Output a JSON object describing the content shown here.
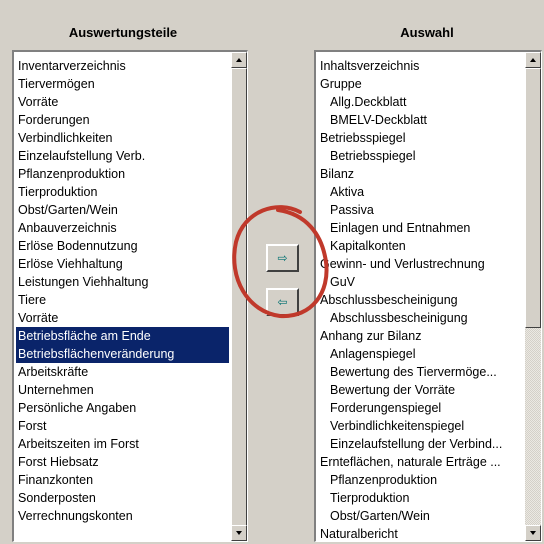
{
  "left_panel": {
    "header": "Auswertungsteile",
    "items": [
      {
        "label": "Inventarverzeichnis"
      },
      {
        "label": "Tiervermögen"
      },
      {
        "label": "Vorräte"
      },
      {
        "label": "Forderungen"
      },
      {
        "label": "Verbindlichkeiten"
      },
      {
        "label": "Einzelaufstellung Verb."
      },
      {
        "label": "Pflanzenproduktion"
      },
      {
        "label": "Tierproduktion"
      },
      {
        "label": "Obst/Garten/Wein"
      },
      {
        "label": "Anbauverzeichnis"
      },
      {
        "label": "Erlöse Bodennutzung"
      },
      {
        "label": "Erlöse Viehhaltung"
      },
      {
        "label": "Leistungen Viehhaltung"
      },
      {
        "label": "Tiere"
      },
      {
        "label": "Vorräte"
      },
      {
        "label": "Betriebsfläche am Ende",
        "selected": true
      },
      {
        "label": "Betriebsflächenveränderung",
        "selected": true
      },
      {
        "label": "Arbeitskräfte"
      },
      {
        "label": "Unternehmen"
      },
      {
        "label": "Persönliche Angaben"
      },
      {
        "label": "Forst"
      },
      {
        "label": "Arbeitszeiten im Forst"
      },
      {
        "label": "Forst Hiebsatz"
      },
      {
        "label": "Finanzkonten"
      },
      {
        "label": "Sonderposten"
      },
      {
        "label": "Verrechnungskonten"
      }
    ]
  },
  "right_panel": {
    "header": "Auswahl",
    "items": [
      {
        "label": "Inhaltsverzeichnis",
        "indent": false
      },
      {
        "label": "Gruppe",
        "indent": false
      },
      {
        "label": "Allg.Deckblatt",
        "indent": true
      },
      {
        "label": "BMELV-Deckblatt",
        "indent": true
      },
      {
        "label": "Betriebsspiegel",
        "indent": false
      },
      {
        "label": "Betriebsspiegel",
        "indent": true
      },
      {
        "label": "Bilanz",
        "indent": false
      },
      {
        "label": "Aktiva",
        "indent": true
      },
      {
        "label": "Passiva",
        "indent": true
      },
      {
        "label": "Einlagen und Entnahmen",
        "indent": true
      },
      {
        "label": "Kapitalkonten",
        "indent": true
      },
      {
        "label": "Gewinn- und Verlustrechnung",
        "indent": false
      },
      {
        "label": "GuV",
        "indent": true
      },
      {
        "label": "Abschlussbescheinigung",
        "indent": false
      },
      {
        "label": "Abschlussbescheinigung",
        "indent": true
      },
      {
        "label": "Anhang zur Bilanz",
        "indent": false
      },
      {
        "label": "Anlagenspiegel",
        "indent": true
      },
      {
        "label": "Bewertung des Tiervermöge...",
        "indent": true
      },
      {
        "label": "Bewertung der Vorräte",
        "indent": true
      },
      {
        "label": "Forderungenspiegel",
        "indent": true
      },
      {
        "label": "Verbindlichkeitenspiegel",
        "indent": true
      },
      {
        "label": "Einzelaufstellung der Verbind...",
        "indent": true
      },
      {
        "label": "Ernteflächen, naturale Erträge ...",
        "indent": false
      },
      {
        "label": "Pflanzenproduktion",
        "indent": true
      },
      {
        "label": "Tierproduktion",
        "indent": true
      },
      {
        "label": "Obst/Garten/Wein",
        "indent": true
      },
      {
        "label": "Naturalbericht",
        "indent": false
      }
    ]
  },
  "buttons": {
    "add": {
      "glyph": "⇨",
      "icon": "arrow-right-icon"
    },
    "remove": {
      "glyph": "⇦",
      "icon": "arrow-left-icon"
    }
  },
  "colors": {
    "selection": "#0a246a",
    "annotation_circle": "#c0392b",
    "arrow": "#007070"
  }
}
